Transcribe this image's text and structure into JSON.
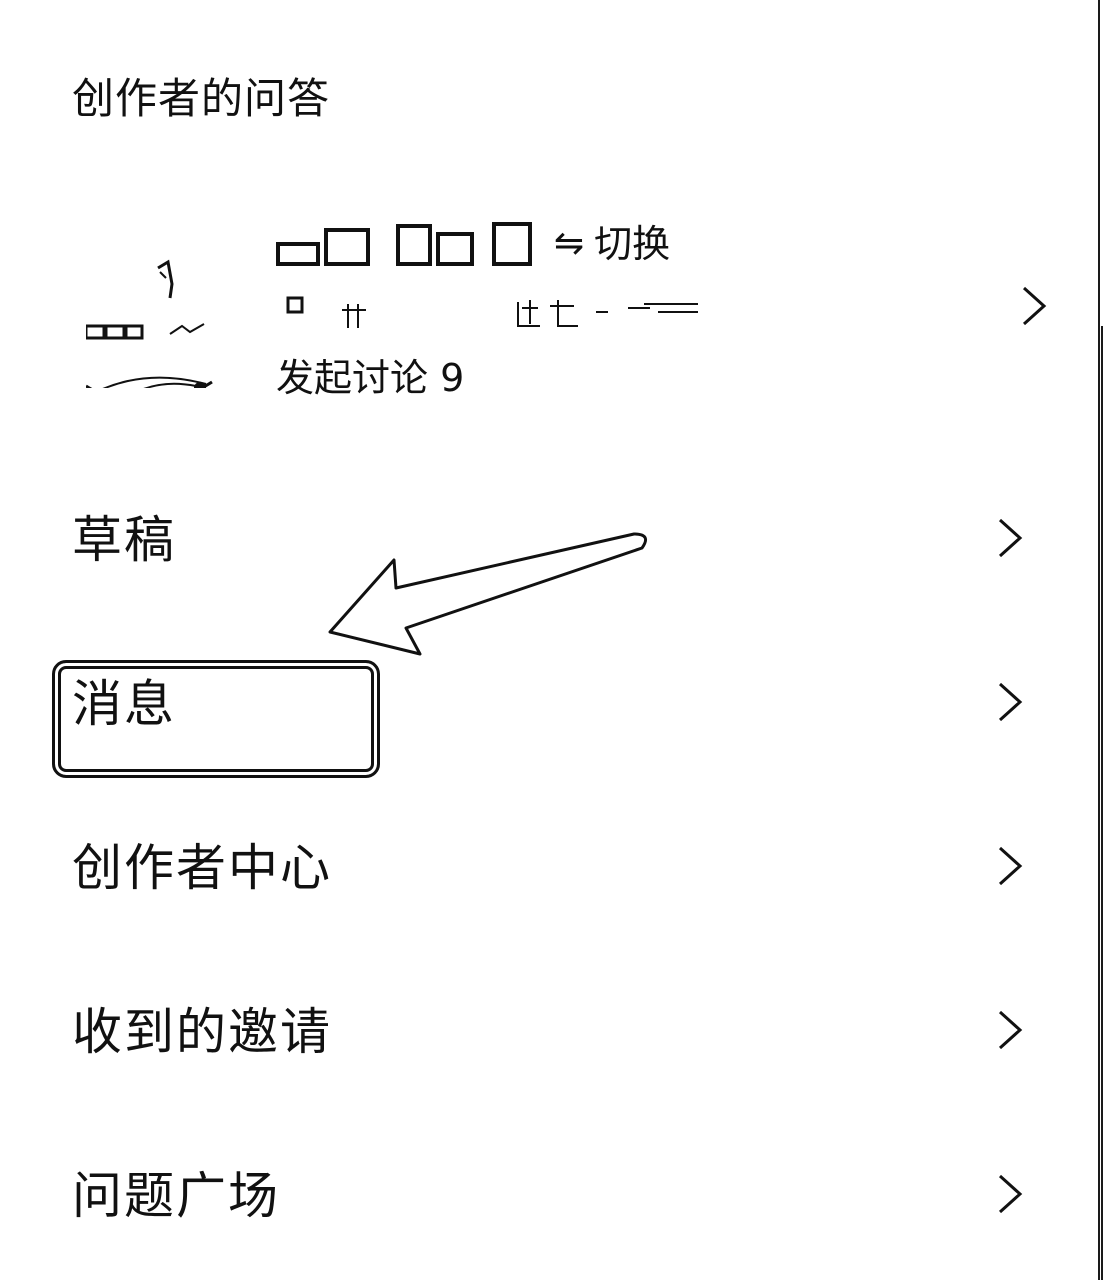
{
  "header": {
    "title": "创作者的问答"
  },
  "profile": {
    "switch_label": "切换",
    "switch_icon": "swap-arrows-icon",
    "discussions_label": "发起讨论 9"
  },
  "menu": {
    "items": [
      {
        "label": "草稿"
      },
      {
        "label": "消息"
      },
      {
        "label": "创作者中心"
      },
      {
        "label": "收到的邀请"
      },
      {
        "label": "问题广场"
      }
    ]
  },
  "annotation": {
    "highlight_target": "消息",
    "arrow": "hand-drawn-arrow"
  }
}
